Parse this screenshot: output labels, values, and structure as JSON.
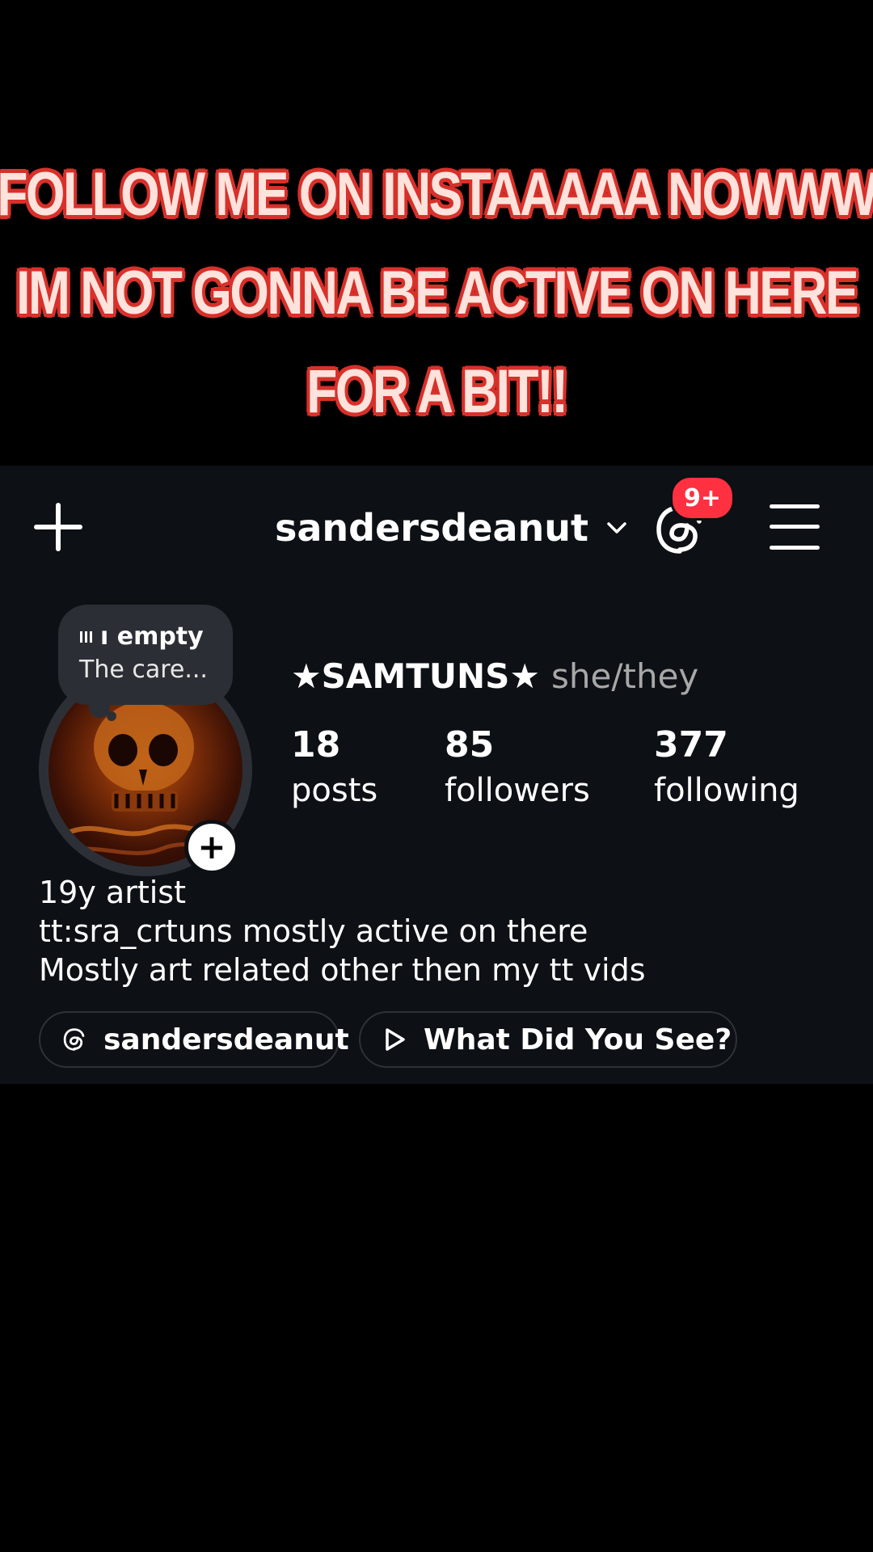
{
  "banner": {
    "lines": [
      "FOLLOW ME ON INSTAAAAA NOWWW",
      "IM NOT GONNA BE ACTIVE ON HERE",
      "FOR A BIT!!"
    ]
  },
  "header": {
    "username": "sandersdeanut",
    "threads_badge": "9+",
    "icons": [
      "plus-icon",
      "chevron-down-icon",
      "threads-icon",
      "menu-icon"
    ]
  },
  "note": {
    "title": "ı empty",
    "subtitle": "The care..."
  },
  "profile": {
    "display_name": "★SAMTUNS★",
    "pronouns": "she/they",
    "stats": [
      {
        "value": "18",
        "label": "posts"
      },
      {
        "value": "85",
        "label": "followers"
      },
      {
        "value": "377",
        "label": "following"
      }
    ],
    "bio": [
      "19y artist",
      "tt:sra_crtuns mostly active on there",
      "Mostly art related other then my tt vids"
    ]
  },
  "links": [
    {
      "label": "sandersdeanut",
      "icon": "threads-icon"
    },
    {
      "label": "What Did You See?",
      "icon": "play-icon"
    }
  ],
  "colors": {
    "banner_text": "#fde3dc",
    "banner_outline": "#d8302a",
    "panel_bg": "#0d1014",
    "badge": "#ff3040",
    "muted_text": "#a8a8a8"
  }
}
